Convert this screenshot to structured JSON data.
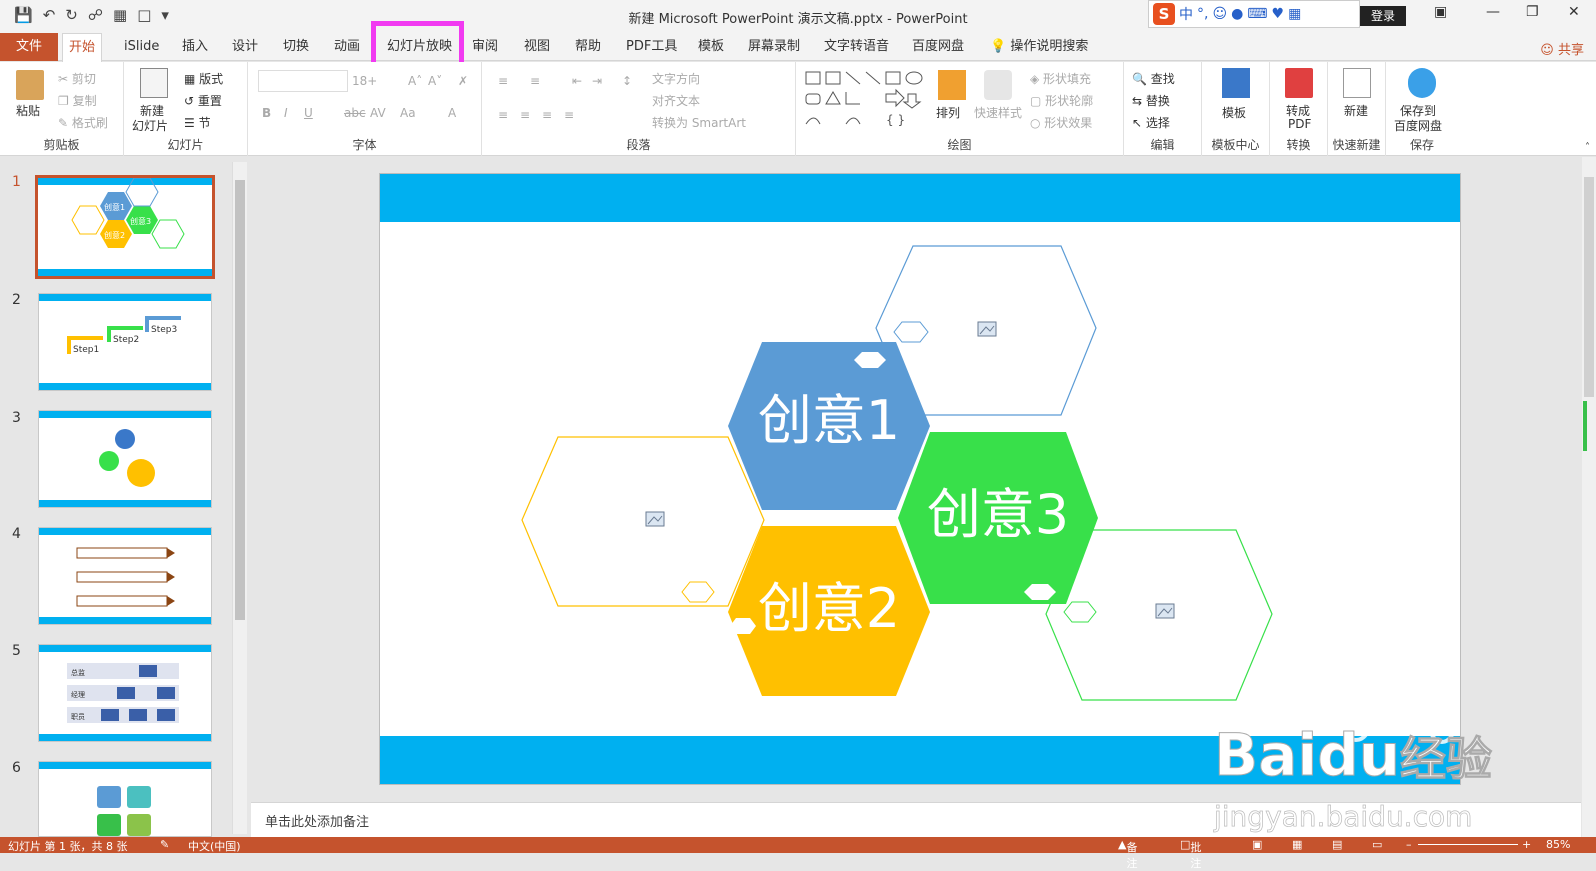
{
  "window": {
    "title": "新建 Microsoft PowerPoint 演示文稿.pptx  -  PowerPoint",
    "login_label": "登录",
    "share_label": "共享"
  },
  "ime": {
    "logo": "S",
    "mode": "中",
    "punct": "°,"
  },
  "tabs": [
    {
      "label": "文件"
    },
    {
      "label": "开始"
    },
    {
      "label": "iSlide"
    },
    {
      "label": "插入"
    },
    {
      "label": "设计"
    },
    {
      "label": "切换"
    },
    {
      "label": "动画"
    },
    {
      "label": "幻灯片放映"
    },
    {
      "label": "审阅"
    },
    {
      "label": "视图"
    },
    {
      "label": "帮助"
    },
    {
      "label": "PDF工具"
    },
    {
      "label": "模板"
    },
    {
      "label": "屏幕录制"
    },
    {
      "label": "文字转语音"
    },
    {
      "label": "百度网盘"
    },
    {
      "label": "操作说明搜索"
    }
  ],
  "ribbon": {
    "clipboard": {
      "label": "剪贴板",
      "paste": "粘贴",
      "cut": "剪切",
      "copy": "复制",
      "format_painter": "格式刷"
    },
    "slides": {
      "label": "幻灯片",
      "new_slide": "新建",
      "new_slide2": "幻灯片",
      "layout": "版式",
      "reset": "重置",
      "section": "节"
    },
    "font": {
      "label": "字体",
      "size": "18+",
      "bold": "B",
      "italic": "I",
      "underline": "U",
      "strike": "abc"
    },
    "paragraph": {
      "label": "段落",
      "text_direction": "文字方向",
      "align_text": "对齐文本",
      "smartart": "转换为 SmartArt"
    },
    "drawing": {
      "label": "绘图",
      "arrange": "排列",
      "quick_styles": "快速样式",
      "shape_fill": "形状填充",
      "shape_outline": "形状轮廓",
      "shape_effects": "形状效果"
    },
    "editing": {
      "label": "编辑",
      "find": "查找",
      "replace": "替换",
      "select": "选择"
    },
    "template_center": {
      "label": "模板中心",
      "template": "模板"
    },
    "convert": {
      "label": "转换",
      "to_pdf": "转成",
      "to_pdf2": "PDF"
    },
    "quick_new": {
      "label": "快速新建",
      "new": "新建"
    },
    "save": {
      "label": "保存",
      "save_to": "保存到",
      "baidu": "百度网盘"
    }
  },
  "thumbnails": [
    {
      "num": "1",
      "texts": [
        "创意1",
        "创意2",
        "创意3"
      ]
    },
    {
      "num": "2",
      "texts": [
        "Step1",
        "Step2",
        "Step3"
      ]
    },
    {
      "num": "3",
      "texts": []
    },
    {
      "num": "4",
      "texts": []
    },
    {
      "num": "5",
      "texts": [
        "总监",
        "经理",
        "职员"
      ]
    },
    {
      "num": "6",
      "texts": []
    }
  ],
  "slide": {
    "hex1": "创意1",
    "hex2": "创意2",
    "hex3": "创意3",
    "colors": {
      "blue": "#5b9bd5",
      "yellow": "#ffc000",
      "green": "#38e04a",
      "band": "#00b0f0"
    }
  },
  "notes_placeholder": "单击此处添加备注",
  "status": {
    "slide_info": "幻灯片 第 1 张，共 8 张",
    "language": "中文(中国)",
    "notes": "备注",
    "comments": "批注",
    "zoom": "85%"
  },
  "watermark": {
    "brand": "Baidu",
    "brand_cn": "经验",
    "url": "jingyan.baidu.com"
  }
}
